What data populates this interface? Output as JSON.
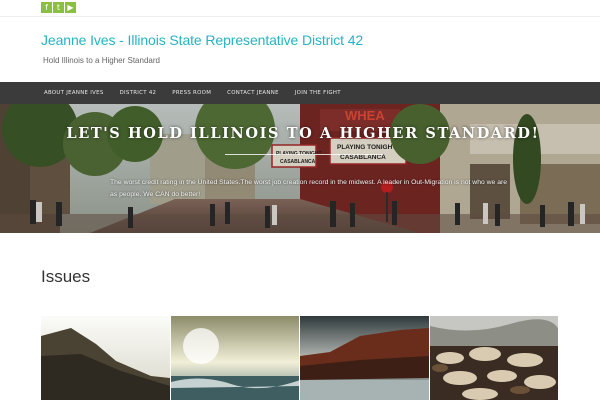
{
  "colors": {
    "accent": "#26b3c2",
    "social_green": "#8bbf3f",
    "nav_bg": "#3b3b3b"
  },
  "social": [
    {
      "icon": "facebook-icon",
      "glyph": "f"
    },
    {
      "icon": "twitter-icon",
      "glyph": "t"
    },
    {
      "icon": "youtube-icon",
      "glyph": "▶"
    }
  ],
  "site": {
    "title": "Jeanne Ives - Illinois State Representative District 42",
    "tagline": "Hold Illinois to a Higher Standard"
  },
  "nav": {
    "items": [
      "ABOUT JEANNE IVES",
      "DISTRICT 42",
      "PRESS ROOM",
      "CONTACT JEANNE",
      "JOIN THE FIGHT"
    ]
  },
  "hero": {
    "title": "LET'S HOLD ILLINOIS TO A HIGHER STANDARD!",
    "subtitle": "The worst credit rating in the United States.The worst job creation record in the midwest. A leader in Out-Migration is not who we are as people. We CAN do better!",
    "marquee_top": "WHEA",
    "marquee_left": "PLAYING TONIGHT",
    "marquee_left2": "CASABLANCA",
    "marquee_right": "PLAYING TONIGHT",
    "marquee_right2": "CASABLANCA"
  },
  "issues": {
    "heading": "Issues"
  }
}
